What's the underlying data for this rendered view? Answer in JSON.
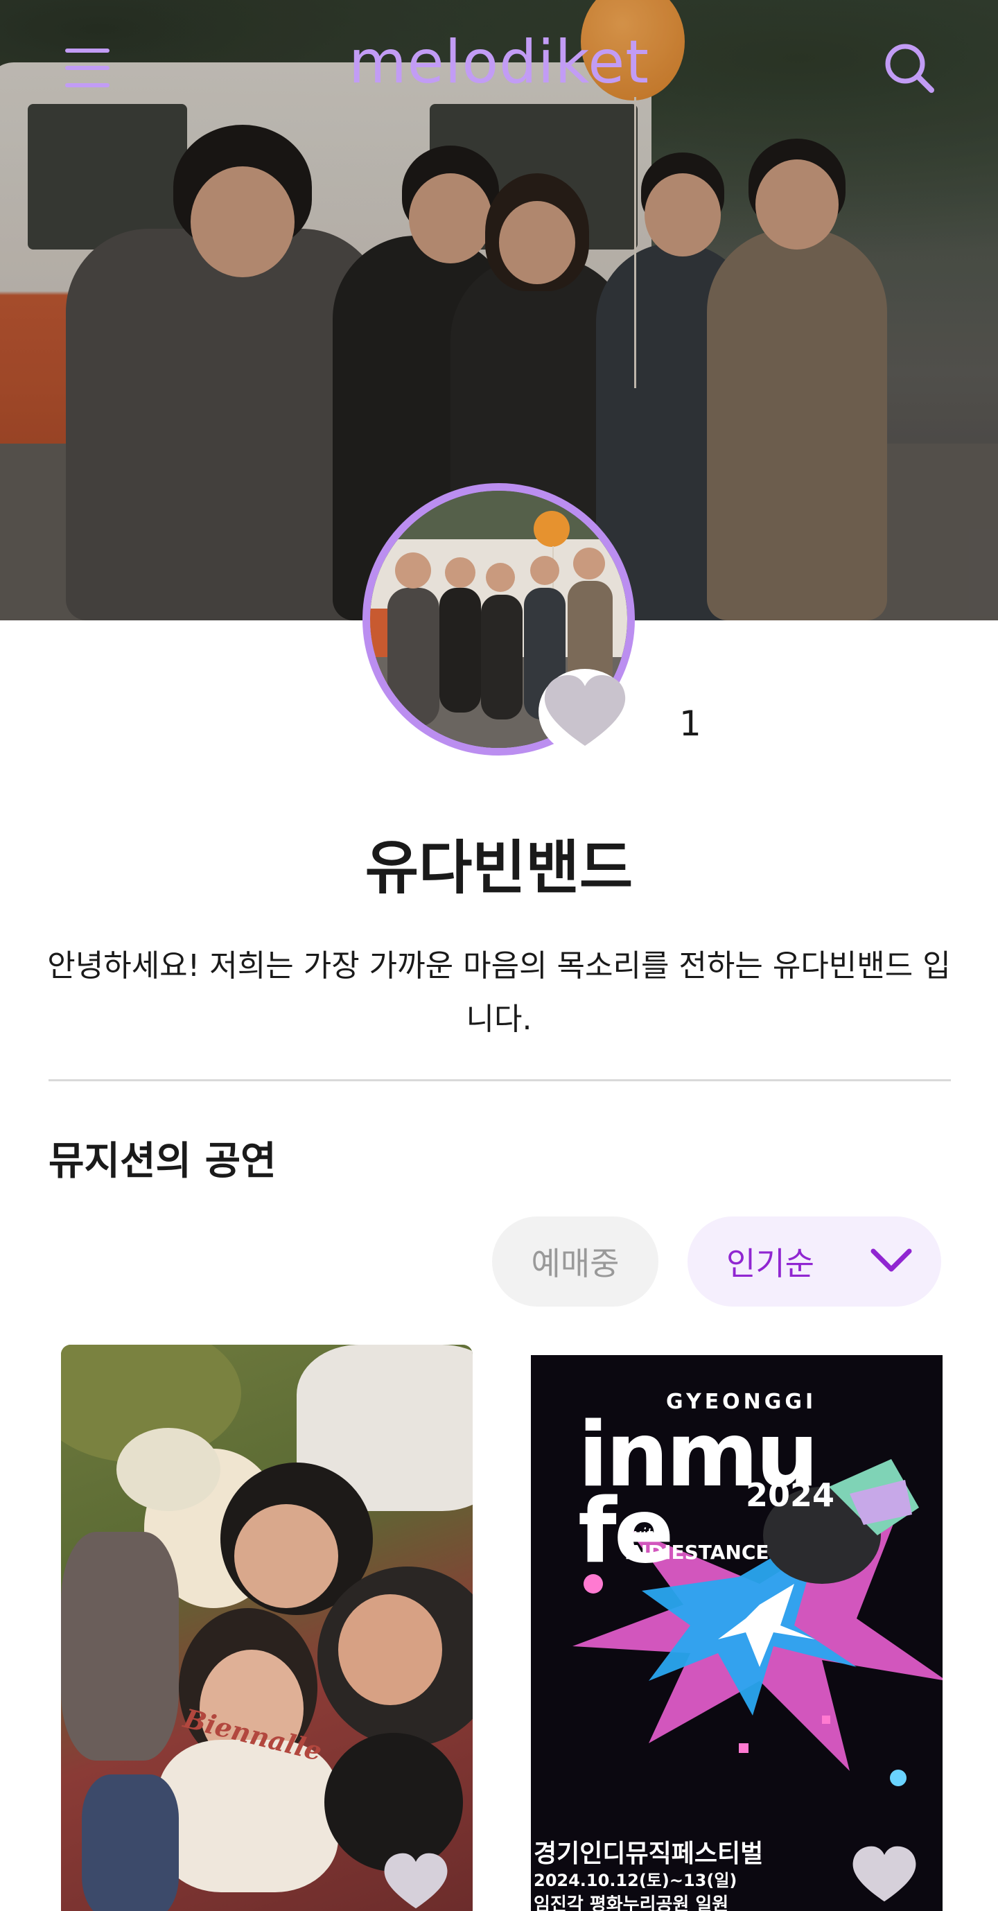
{
  "header": {
    "logo_text": "melodiket",
    "menu_icon": "hamburger-menu-icon",
    "search_icon": "search-icon",
    "accent_color": "#c29cf5"
  },
  "profile": {
    "like_icon": "heart-icon",
    "like_count": "1",
    "band_name": "유다빈밴드",
    "intro": "안녕하세요! 저희는 가장 가까운 마음의 목소리를 전하는 유다빈밴드 입니다.",
    "avatar_ring_color": "#bb8ef0"
  },
  "shows_section": {
    "title": "뮤지션의 공연",
    "filter_onsale": "예매중",
    "sort_label": "인기순",
    "sort_icon": "chevron-down-icon",
    "sort_color": "#9026d1"
  },
  "shows": [
    {
      "poster_text": "Biennalle",
      "like_icon": "heart-icon"
    },
    {
      "like_icon": "heart-icon",
      "poster_header": "GYEONGGI",
      "poster_logo_line1": "inmu",
      "poster_logo_line2": "fe",
      "poster_year": "2024",
      "poster_with": "with",
      "poster_sub": "INDIESTANCE",
      "poster_title": "경기인디뮤직페스티벌",
      "poster_date": "2024.10.12(토)~13(일)",
      "poster_venue": "임진각 평화누리공원 일원"
    }
  ]
}
